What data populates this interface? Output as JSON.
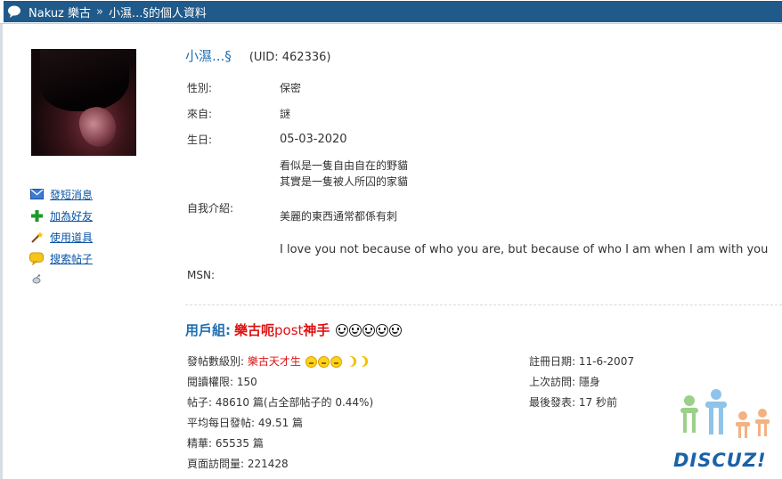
{
  "header": {
    "crumbs": [
      "Nakuz 樂古",
      "小濕...§的個人資料"
    ],
    "separator": "»"
  },
  "sidebar": {
    "actions": [
      {
        "label": "發短消息",
        "icon": "envelope-icon"
      },
      {
        "label": "加為好友",
        "icon": "plus-icon"
      },
      {
        "label": "使用道具",
        "icon": "magic-wand-icon"
      },
      {
        "label": "搜索帖子",
        "icon": "speech-bubble-icon"
      }
    ],
    "extra_icon": "satellite-icon"
  },
  "profile": {
    "username": "小濕...§",
    "uid": "(UID: 462336)",
    "fields": {
      "gender": {
        "label": "性別:",
        "value": "保密"
      },
      "from": {
        "label": "來自:",
        "value": "謎"
      },
      "birthday": {
        "label": "生日:",
        "value": "05-03-2020"
      },
      "bio_label": "自我介紹:",
      "bio_lines": [
        "看似是一隻自由自在的野貓",
        "其實是一隻被人所囚的家貓",
        "美麗的東西通常都係有刺",
        "I love you not because of who you are, but because of who I am when I am with you"
      ],
      "msn_label": "MSN:"
    }
  },
  "usergroup": {
    "label": "用戶組:",
    "name_part1": "樂古呃",
    "name_part2": "post",
    "name_part3": "神手",
    "stars": 5
  },
  "stats_left": {
    "rank_label": "發帖數級別:",
    "rank_value": "樂古天才生",
    "read_perm": "閱讀權限: 150",
    "posts": "帖子: 48610 篇(占全部帖子的 0.44%)",
    "avg_posts": "平均每日發帖: 49.51 篇",
    "digest": "精華: 65535 篇",
    "page_views": "頁面訪問量: 221428"
  },
  "stats_right": {
    "reg_date": "註冊日期: 11-6-2007",
    "last_visit": "上次訪問: 隱身",
    "last_post": "最後發表: 17 秒前"
  },
  "logo": {
    "text": "DISCUZ!"
  },
  "colors": {
    "title_bar": "#1f5a8a",
    "link": "#0b55a6",
    "accent_blue": "#1f6fb2",
    "rank_red": "#dd1111"
  }
}
